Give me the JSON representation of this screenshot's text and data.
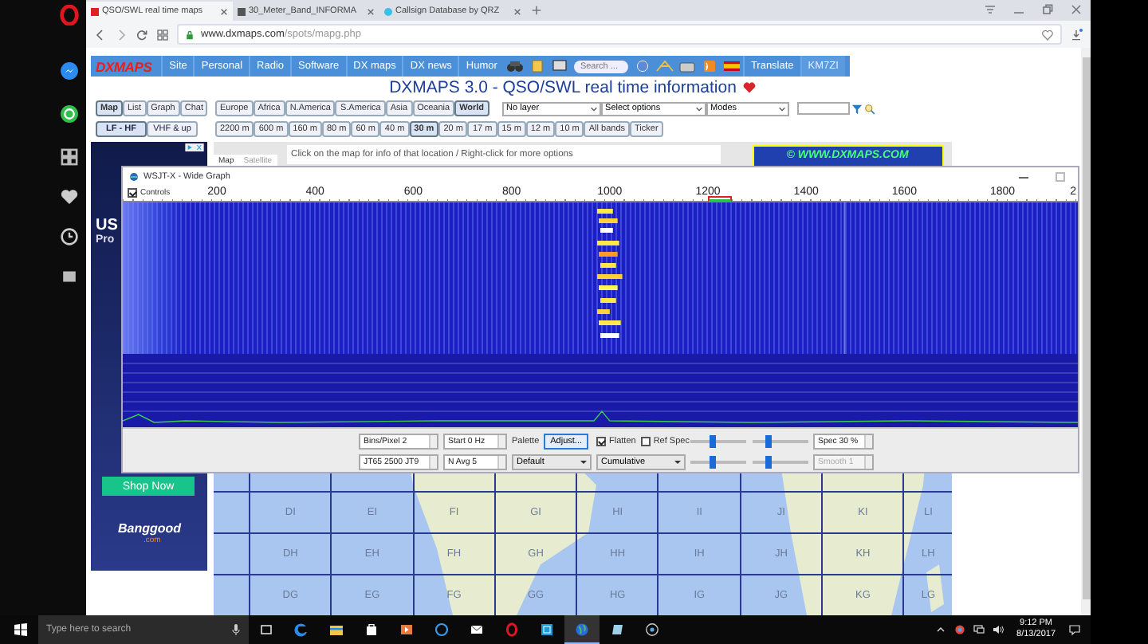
{
  "browser": {
    "tabs": [
      {
        "title": "QSO/SWL real time maps",
        "selected": true
      },
      {
        "title": "30_Meter_Band_INFORMA",
        "selected": false
      },
      {
        "title": "Callsign Database by QRZ",
        "selected": false
      }
    ],
    "address_host": "www.dxmaps.com",
    "address_path": "/spots/mapg.php"
  },
  "nav": {
    "logo": "DXMAPS",
    "items": [
      "Site",
      "Personal",
      "Radio",
      "Software",
      "DX maps",
      "DX news",
      "Humor"
    ],
    "search_placeholder": "Search ...",
    "translate": "Translate",
    "user": "KM7ZI"
  },
  "title": "DXMAPS 3.0 - QSO/SWL real time information",
  "view_tabs": [
    {
      "label": "Map",
      "selected": true
    },
    {
      "label": "List",
      "selected": false
    },
    {
      "label": "Graph",
      "selected": false
    },
    {
      "label": "Chat",
      "selected": false
    }
  ],
  "regions": [
    {
      "label": "Europe",
      "selected": false
    },
    {
      "label": "Africa",
      "selected": false
    },
    {
      "label": "N.America",
      "selected": false
    },
    {
      "label": "S.America",
      "selected": false
    },
    {
      "label": "Asia",
      "selected": false
    },
    {
      "label": "Oceania",
      "selected": false
    },
    {
      "label": "World",
      "selected": true
    }
  ],
  "selects": [
    "No layer",
    "Select options",
    "Modes"
  ],
  "modes": [
    {
      "label": "LF - HF",
      "selected": true
    },
    {
      "label": "VHF & up",
      "selected": false
    }
  ],
  "bands": [
    {
      "label": "2200 m",
      "selected": false
    },
    {
      "label": "600 m",
      "selected": false
    },
    {
      "label": "160 m",
      "selected": false
    },
    {
      "label": "80 m",
      "selected": false
    },
    {
      "label": "60 m",
      "selected": false
    },
    {
      "label": "40 m",
      "selected": false
    },
    {
      "label": "30 m",
      "selected": true
    },
    {
      "label": "20 m",
      "selected": false
    },
    {
      "label": "17 m",
      "selected": false
    },
    {
      "label": "15 m",
      "selected": false
    },
    {
      "label": "12 m",
      "selected": false
    },
    {
      "label": "10 m",
      "selected": false
    },
    {
      "label": "All bands",
      "selected": false
    },
    {
      "label": "Ticker",
      "selected": false
    }
  ],
  "ad": {
    "headline": "US",
    "subline": "Pro",
    "button": "Shop Now",
    "logo": "Banggood",
    "logo_domain": ".com"
  },
  "map": {
    "buttons": [
      {
        "label": "Map",
        "selected": true
      },
      {
        "label": "Satellite",
        "selected": false
      }
    ],
    "hint": "Click on the map for info of that location / Right-click for more options",
    "copyright": "© WWW.DXMAPS.COM",
    "rows": [
      [
        "DI",
        "EI",
        "FI",
        "GI",
        "HI",
        "II",
        "JI",
        "KI",
        "LI"
      ],
      [
        "DH",
        "EH",
        "FH",
        "GH",
        "HH",
        "IH",
        "JH",
        "KH",
        "LH"
      ],
      [
        "DG",
        "EG",
        "FG",
        "GG",
        "HG",
        "IG",
        "JG",
        "KG",
        "LG"
      ]
    ]
  },
  "wide_graph": {
    "title": "WSJT-X - Wide Graph",
    "controls": {
      "label": "Controls",
      "checked": true
    },
    "ruler": [
      "200",
      "400",
      "600",
      "800",
      "1000",
      "1200",
      "1400",
      "1600",
      "1800",
      "2"
    ],
    "bins": "Bins/Pixel  2",
    "start": "Start 0 Hz",
    "mode": "JT65  2500  JT9",
    "navg": "N Avg 5",
    "palette_label": "Palette",
    "adjust": "Adjust...",
    "palette": "Default",
    "flatten": {
      "label": "Flatten",
      "checked": true
    },
    "ref_spec": {
      "label": "Ref Spec",
      "checked": false
    },
    "spectrum": "Cumulative",
    "sliders": [
      {
        "level": 0.4
      },
      {
        "level": 0.28
      },
      {
        "level": 0.4
      },
      {
        "level": 0.28
      }
    ],
    "spec": {
      "label": "Spec 30 %",
      "disabled": false
    },
    "smooth": {
      "label": "Smooth  1",
      "disabled": true
    }
  },
  "taskbar": {
    "search_placeholder": "Type here to search",
    "apps": [
      {
        "kind": "taskview",
        "selected": false
      },
      {
        "kind": "edge",
        "selected": false
      },
      {
        "kind": "folder",
        "selected": false
      },
      {
        "kind": "store",
        "selected": false
      },
      {
        "kind": "media",
        "selected": false
      },
      {
        "kind": "ring",
        "selected": false
      },
      {
        "kind": "mail",
        "selected": false
      },
      {
        "kind": "opera",
        "selected": false
      },
      {
        "kind": "tile",
        "selected": false
      },
      {
        "kind": "globe",
        "selected": true
      },
      {
        "kind": "notes",
        "selected": false
      },
      {
        "kind": "record",
        "selected": false
      }
    ],
    "time": "9:12 PM",
    "date": "8/13/2017"
  }
}
